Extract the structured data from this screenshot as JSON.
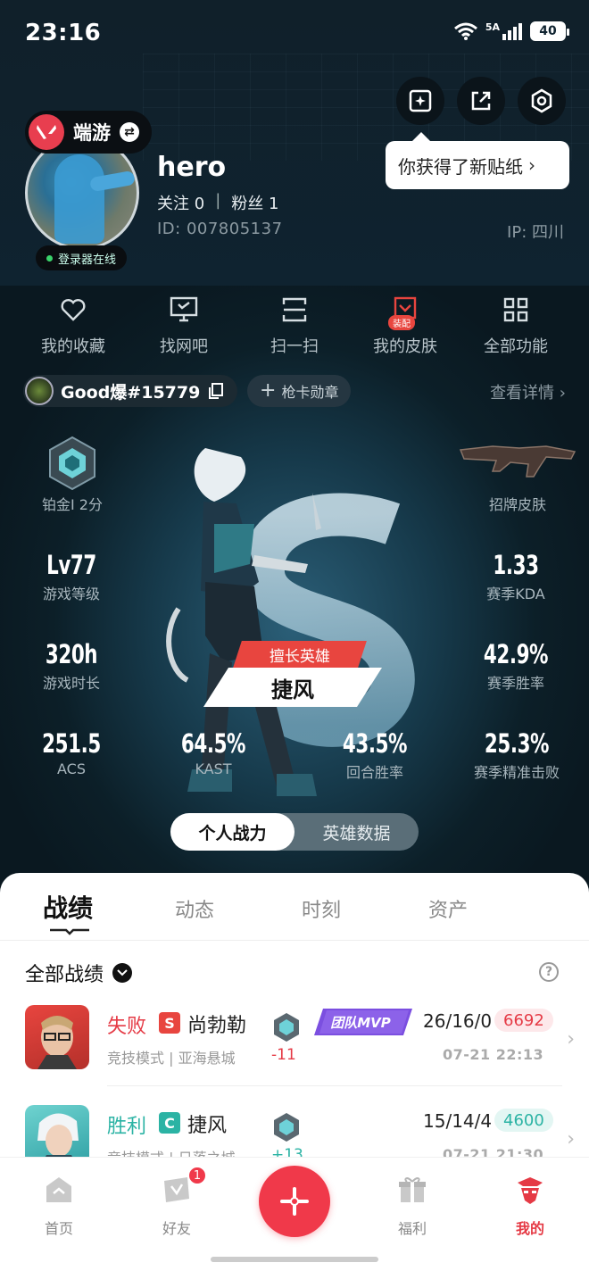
{
  "status_bar": {
    "time": "23:16",
    "network": "5A",
    "battery": "40"
  },
  "top_actions": {
    "tooltip": "你获得了新贴纸"
  },
  "profile": {
    "game_badge": "端游",
    "online_status": "登录器在线",
    "username": "hero",
    "follow_label": "关注 0",
    "fans_label": "粉丝 1",
    "separator": "|",
    "id": "ID:  007805137",
    "ip": "IP:  四川"
  },
  "quick_menu": [
    {
      "label": "我的收藏",
      "icon": "heart-icon"
    },
    {
      "label": "找网吧",
      "icon": "monitor-icon"
    },
    {
      "label": "扫一扫",
      "icon": "scan-icon"
    },
    {
      "label": "我的皮肤",
      "icon": "skin-icon",
      "tag": "装配"
    },
    {
      "label": "全部功能",
      "icon": "grid-icon"
    }
  ],
  "player": {
    "riot_id": "Good爆#15779",
    "badge_button": "枪卡勋章",
    "details_link": "查看详情"
  },
  "stats": {
    "rank": "铂金I 2分",
    "signature_skin": "招牌皮肤",
    "level": {
      "value": "Lv77",
      "label": "游戏等级"
    },
    "kda": {
      "value": "1.33",
      "label": "赛季KDA"
    },
    "playtime": {
      "value": "320h",
      "label": "游戏时长"
    },
    "winrate": {
      "value": "42.9%",
      "label": "赛季胜率"
    },
    "acs": {
      "value": "251.5",
      "label": "ACS"
    },
    "kast": {
      "value": "64.5%",
      "label": "KAST"
    },
    "round_win": {
      "value": "43.5%",
      "label": "回合胜率"
    },
    "headshot": {
      "value": "25.3%",
      "label": "赛季精准击败"
    }
  },
  "main_hero": {
    "tag": "擅长英雄",
    "name": "捷风"
  },
  "segment": {
    "active": "个人战力",
    "other": "英雄数据"
  },
  "tabs": [
    "战绩",
    "动态",
    "时刻",
    "资产"
  ],
  "filter": {
    "label": "全部战绩",
    "help": "?"
  },
  "matches": [
    {
      "result": "失败",
      "result_color": "#e53a45",
      "mode_letter": "S",
      "mode_color": "#e8453f",
      "agent": "尚勃勒",
      "sub": "竞技模式 | 亚海悬城",
      "delta": "-11",
      "delta_color": "#e53a45",
      "mvp": "团队MVP",
      "kda": "26/16/0",
      "score": "6692",
      "score_color": "#e53a45",
      "score_bg": "#fde8ea",
      "time": "07-21 22:13"
    },
    {
      "result": "胜利",
      "result_color": "#2bb3a4",
      "mode_letter": "C",
      "mode_color": "#2bb3a4",
      "agent": "捷风",
      "sub": "竞技模式 | 日落之城",
      "delta": "+13",
      "delta_color": "#2bb3a4",
      "kda": "15/14/4",
      "score": "4600",
      "score_color": "#2bb3a4",
      "score_bg": "#e3f6f3",
      "time": "07-21 21:30"
    }
  ],
  "nav": {
    "home": "首页",
    "friends": "好友",
    "friends_badge": "1",
    "welfare": "福利",
    "mine": "我的"
  },
  "colors": {
    "accent": "#f0394a",
    "win": "#2bb3a4",
    "loss": "#e53a45"
  }
}
